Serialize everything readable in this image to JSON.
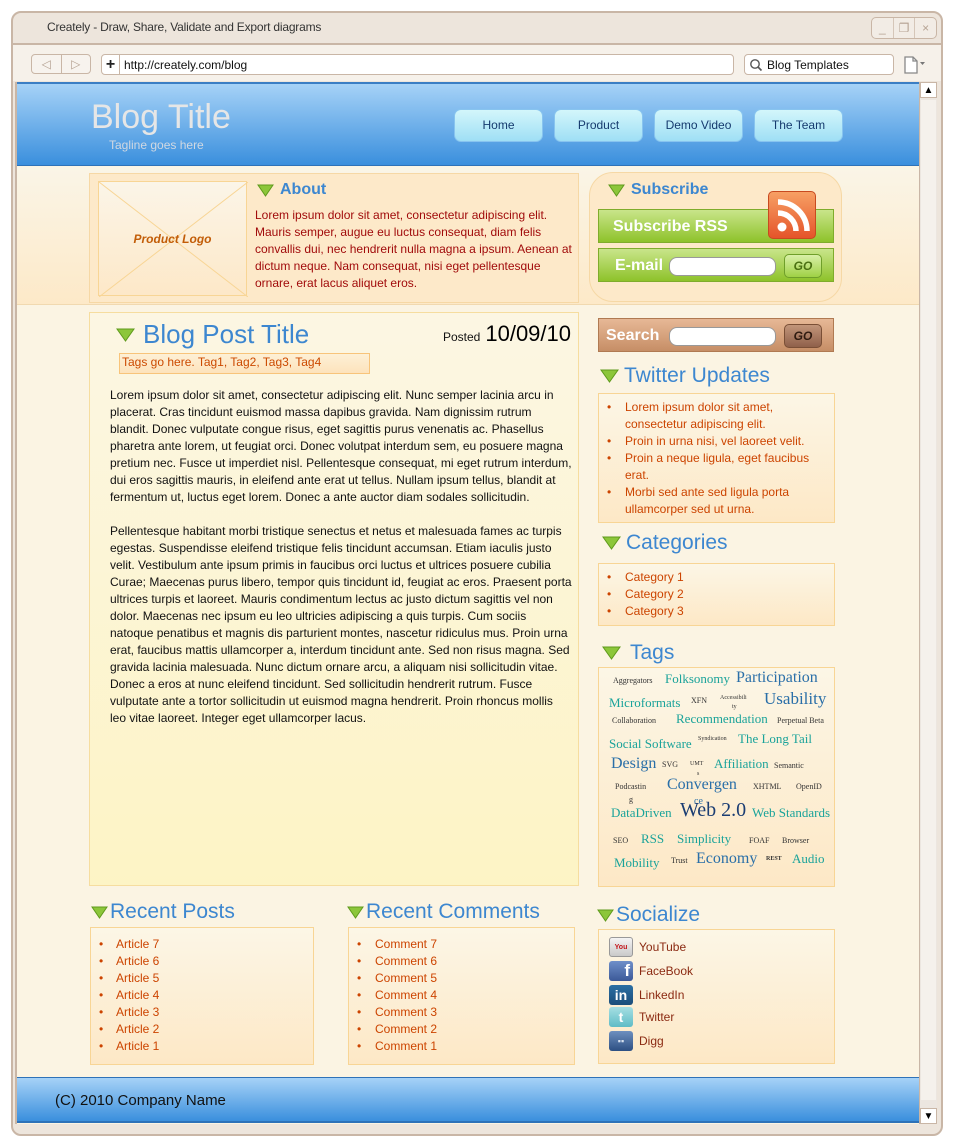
{
  "browser": {
    "window_title": "Creately - Draw, Share, Validate and Export diagrams",
    "url": "http://creately.com/blog",
    "search_value": "Blog Templates",
    "controls": {
      "minimize": "_",
      "restore": "❐",
      "close": "×"
    },
    "back": "◁",
    "forward": "▷",
    "add_tab": "+"
  },
  "header": {
    "title": "Blog Title",
    "tagline": "Tagline goes here",
    "nav": [
      {
        "label": "Home"
      },
      {
        "label": "Product"
      },
      {
        "label": "Demo Video"
      },
      {
        "label": "The Team"
      }
    ]
  },
  "about": {
    "logo_label": "Product Logo",
    "heading": "About",
    "text": "Lorem ipsum dolor sit amet, consectetur adipiscing elit. Mauris semper, augue eu luctus consequat, diam felis convallis dui, nec hendrerit nulla magna a ipsum. Aenean at dictum neque. Nam consequat, nisi eget pellentesque ornare, erat lacus aliquet eros."
  },
  "subscribe": {
    "heading": "Subscribe",
    "rss_label": "Subscribe RSS",
    "email_label": "E-mail",
    "email_value": "",
    "go_label": "GO"
  },
  "post": {
    "title": "Blog Post Title",
    "posted_label": "Posted",
    "date": "10/09/10",
    "tags": "Tags go here. Tag1, Tag2, Tag3, Tag4",
    "paragraphs": [
      "Lorem ipsum dolor sit amet, consectetur adipiscing elit. Nunc semper lacinia arcu in placerat. Cras tincidunt euismod massa dapibus gravida. Nam dignissim rutrum blandit. Donec vulputate congue risus, eget sagittis purus venenatis ac. Phasellus pharetra ante lorem, ut feugiat orci. Donec volutpat interdum sem, eu posuere magna pretium nec. Fusce ut imperdiet nisl. Pellentesque consequat, mi eget rutrum interdum, dui eros sagittis mauris, in eleifend ante erat ut tellus. Nullam ipsum tellus, blandit at fermentum ut, luctus eget lorem. Donec a ante auctor diam sodales sollicitudin.",
      "Pellentesque habitant morbi tristique senectus et netus et malesuada fames ac turpis egestas. Suspendisse eleifend tristique felis tincidunt accumsan. Etiam iaculis justo velit. Vestibulum ante ipsum primis in faucibus orci luctus et ultrices posuere cubilia Curae; Maecenas purus libero, tempor quis tincidunt id, feugiat ac eros. Praesent porta ultrices turpis et laoreet. Mauris condimentum lectus ac justo dictum sagittis vel non dolor. Maecenas nec ipsum eu leo ultricies adipiscing a quis turpis. Cum sociis natoque penatibus et magnis dis parturient montes, nascetur ridiculus mus. Proin urna erat, faucibus mattis ullamcorper a, interdum tincidunt ante. Sed non risus magna. Sed gravida lacinia malesuada. Nunc dictum ornare arcu, a aliquam nisi sollicitudin vitae. Donec a eros at nunc eleifend tincidunt. Sed sollicitudin hendrerit rutrum. Fusce vulputate ante a tortor sollicitudin ut euismod magna hendrerit. Proin rhoncus mollis leo vitae laoreet. Integer eget ullamcorper lacus."
    ]
  },
  "search": {
    "label": "Search",
    "value": "",
    "go_label": "GO"
  },
  "twitter": {
    "heading": "Twitter Updates",
    "items": [
      "Lorem ipsum dolor sit amet, consectetur adipiscing elit.",
      " Proin in urna nisi, vel laoreet velit.",
      "Proin a neque ligula, eget faucibus erat.",
      "Morbi sed ante sed ligula porta ullamcorper sed ut urna."
    ]
  },
  "categories": {
    "heading": "Categories",
    "items": [
      "Category 1",
      "Category 2",
      "Category 3"
    ]
  },
  "tags": {
    "heading": "Tags",
    "cloud": [
      "Aggregators",
      "Folksonomy",
      "Participation",
      "Microformats",
      "XFN",
      "Accessibili",
      "ty",
      "Usability",
      "Collaboration",
      "Recommendation",
      "Perpetual Beta",
      "Social Software",
      "Syndication",
      "The Long Tail",
      "Design",
      "SVG",
      "UMT",
      "s",
      "Affiliation",
      "Semantic",
      "Podcastin",
      "g",
      "Convergen",
      "ce",
      "XHTML",
      "OpenID",
      "DataDriven",
      "Web 2.0",
      "Web Standards",
      "SEO",
      "RSS",
      "Simplicity",
      "FOAF",
      "Browser",
      "Mobility",
      "Trust",
      "Economy",
      "REST",
      "Audio"
    ],
    "colors": {
      "dark": "#333333",
      "teal": "#1aa39a",
      "blue": "#2a6fa8",
      "navy": "#1b3d73"
    }
  },
  "recent_posts": {
    "heading": "Recent Posts",
    "items": [
      "Article 7",
      "Article 6",
      "Article 5",
      "Article 4",
      "Article 3",
      "Article 2",
      "Article 1"
    ]
  },
  "recent_comments": {
    "heading": "Recent Comments",
    "items": [
      "Comment 7",
      "Comment 6",
      "Comment 5",
      "Comment 4",
      "Comment 3",
      "Comment 2",
      "Comment 1"
    ]
  },
  "socialize": {
    "heading": "Socialize",
    "items": [
      {
        "label": "YouTube",
        "icon": "youtube-icon",
        "glyph": "You"
      },
      {
        "label": "FaceBook",
        "icon": "facebook-icon",
        "glyph": "f"
      },
      {
        "label": "LinkedIn",
        "icon": "linkedin-icon",
        "glyph": "in"
      },
      {
        "label": "Twitter",
        "icon": "twitter-icon",
        "glyph": "t"
      },
      {
        "label": "Digg",
        "icon": "digg-icon",
        "glyph": "▪▪"
      }
    ]
  },
  "footer": {
    "text": "(C) 2010 Company Name"
  },
  "colors": {
    "accent_blue": "#3d87d0",
    "link_orange": "#cc4400",
    "about_red": "#a10b0b",
    "triangle_green": "#7ab52a",
    "header_top": "#a6d2f7",
    "header_bottom": "#3a8fdd"
  }
}
